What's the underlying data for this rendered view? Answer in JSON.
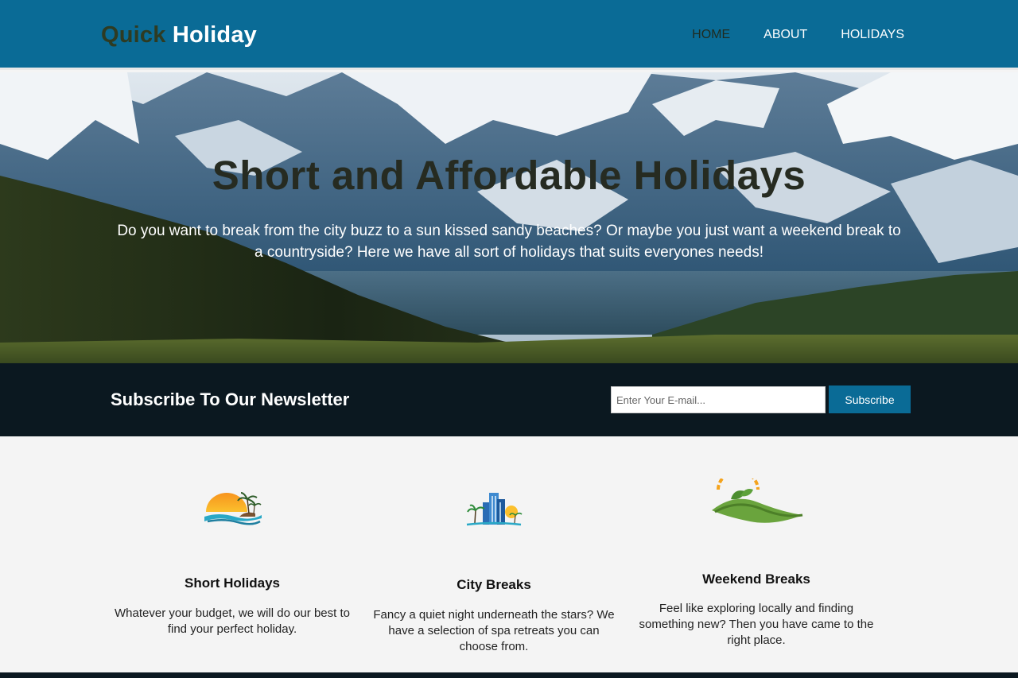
{
  "header": {
    "logo_part1": "Quick",
    "logo_part2": "Holiday",
    "nav": [
      {
        "label": "HOME"
      },
      {
        "label": "ABOUT"
      },
      {
        "label": "HOLIDAYS"
      }
    ]
  },
  "hero": {
    "title": "Short and Affordable Holidays",
    "text": "Do you want to break from the city buzz to a sun kissed sandy beaches? Or maybe you just want a weekend break to a countryside? Here we have all sort of holidays that suits everyones needs!"
  },
  "newsletter": {
    "title": "Subscribe To Our Newsletter",
    "placeholder": "Enter Your E-mail...",
    "button": "Subscribe"
  },
  "features": [
    {
      "title": "Short Holidays",
      "text": "Whatever your budget, we will do our best to find your perfect holiday.",
      "icon": "beach-sunset-icon"
    },
    {
      "title": "City Breaks",
      "text": "Fancy a quiet night underneath the stars? We have a selection of spa retreats you can choose from.",
      "icon": "city-buildings-icon"
    },
    {
      "title": "Weekend Breaks",
      "text": "Feel like exploring locally and finding something new? Then you have came to the right place.",
      "icon": "countryside-leaf-icon"
    }
  ],
  "colors": {
    "brand": "#0a6b96",
    "dark": "#0b1820"
  }
}
